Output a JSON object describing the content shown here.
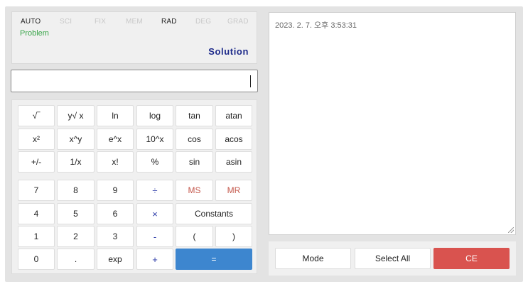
{
  "display": {
    "modes": [
      {
        "label": "AUTO",
        "active": true
      },
      {
        "label": "SCI",
        "active": false
      },
      {
        "label": "FIX",
        "active": false
      },
      {
        "label": "MEM",
        "active": false
      },
      {
        "label": "RAD",
        "active": true
      },
      {
        "label": "DEG",
        "active": false
      },
      {
        "label": "GRAD",
        "active": false
      }
    ],
    "problem_label": "Problem",
    "solution_label": "Solution",
    "input_value": ""
  },
  "keypad": {
    "row1": [
      "√‾",
      "y√ x",
      "ln",
      "log",
      "tan",
      "atan"
    ],
    "row2": [
      "x²",
      "x^y",
      "e^x",
      "10^x",
      "cos",
      "acos"
    ],
    "row3": [
      "+/-",
      "1/x",
      "x!",
      "%",
      "sin",
      "asin"
    ],
    "row4": [
      "7",
      "8",
      "9",
      "÷",
      "MS",
      "MR"
    ],
    "row5": [
      "4",
      "5",
      "6",
      "×",
      "Constants"
    ],
    "row6": [
      "1",
      "2",
      "3",
      "-",
      "(",
      ")"
    ],
    "row7": [
      "0",
      ".",
      "exp",
      "+",
      "="
    ]
  },
  "log": {
    "text": "2023. 2. 7. 오후 3:53:31"
  },
  "bottom": {
    "mode_label": "Mode",
    "select_all_label": "Select All",
    "ce_label": "CE"
  },
  "colors": {
    "equals_button": "#3d86cf",
    "ce_button": "#d9534f",
    "operator_text": "#2b3aa8",
    "memory_text": "#c4574b",
    "problem_text": "#3aa64a",
    "solution_text": "#1d2a8a"
  }
}
